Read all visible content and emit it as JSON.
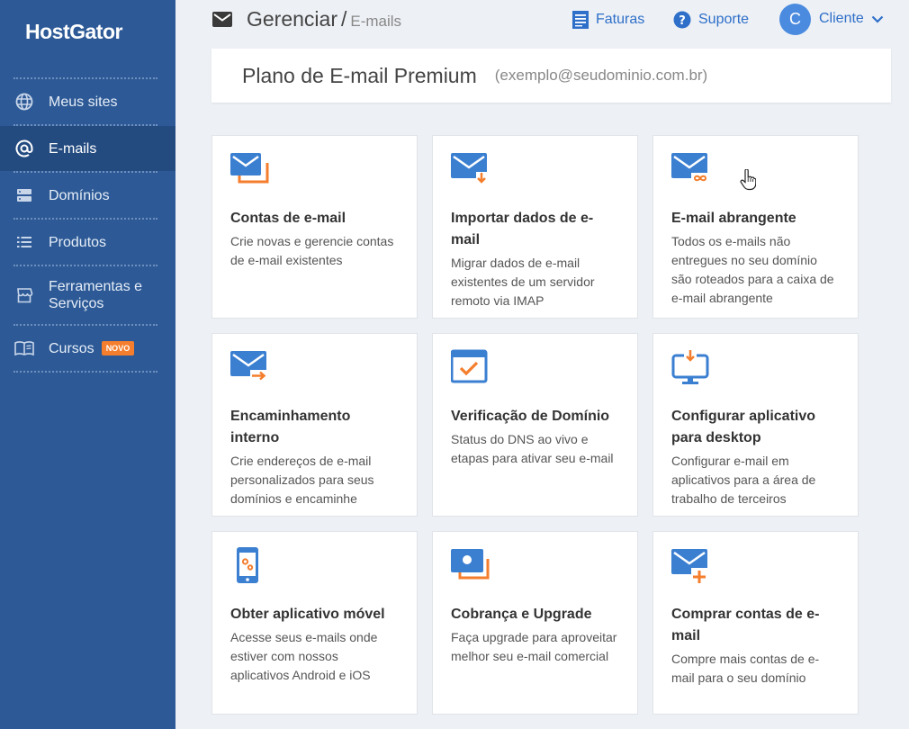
{
  "sidebar": {
    "logo": "HostGator",
    "items": [
      {
        "label": "Meus sites",
        "icon": "globe-icon"
      },
      {
        "label": "E-mails",
        "icon": "at-icon",
        "active": true
      },
      {
        "label": "Domínios",
        "icon": "server-icon"
      },
      {
        "label": "Produtos",
        "icon": "list-icon"
      },
      {
        "label": "Ferramentas e Serviços",
        "icon": "store-icon"
      },
      {
        "label": "Cursos",
        "icon": "book-icon",
        "badge": "NOVO"
      }
    ]
  },
  "header": {
    "breadcrumb_main": "Gerenciar",
    "breadcrumb_sep": "/",
    "breadcrumb_sub": "E-mails",
    "faturas": "Faturas",
    "suporte": "Suporte",
    "avatar_initial": "C",
    "user": "Cliente"
  },
  "plan": {
    "title": "Plano de E-mail Premium",
    "domain": "(exemplo@seudominio.com.br)"
  },
  "cards": [
    {
      "title": "Contas de e-mail",
      "desc": "Crie novas e gerencie contas de e-mail existentes",
      "icon": "mail-accounts-icon"
    },
    {
      "title": "Importar dados de e-mail",
      "desc": "Migrar dados de e-mail existentes de um servidor remoto via IMAP",
      "icon": "mail-import-icon"
    },
    {
      "title": "E-mail abrangente",
      "desc": "Todos os e-mails não entregues no seu domínio são roteados para a caixa de e-mail abrangente",
      "icon": "mail-catchall-icon"
    },
    {
      "title": "Encaminhamento interno",
      "desc": "Crie endereços de e-mail personalizados para seus domínios e encaminhe",
      "icon": "mail-forward-icon"
    },
    {
      "title": "Verificação de Domínio",
      "desc": "Status do DNS ao vivo e etapas para ativar seu e-mail",
      "icon": "domain-check-icon"
    },
    {
      "title": "Configurar aplicativo para desktop",
      "desc": "Configurar e-mail em aplicativos para a área de trabalho de terceiros",
      "icon": "desktop-download-icon"
    },
    {
      "title": "Obter aplicativo móvel",
      "desc": "Acesse seus e-mails onde estiver com nossos aplicativos Android e iOS",
      "icon": "mobile-app-icon"
    },
    {
      "title": "Cobrança e Upgrade",
      "desc": "Faça upgrade para aproveitar melhor seu e-mail comercial",
      "icon": "billing-icon"
    },
    {
      "title": "Comprar contas de e-mail",
      "desc": "Compre mais contas de e-mail para o seu domínio",
      "icon": "mail-add-icon"
    }
  ],
  "colors": {
    "sidebar": "#2d5a96",
    "accent_blue": "#3b7fd1",
    "accent_orange": "#f47e2d",
    "link": "#2e6fc9"
  }
}
